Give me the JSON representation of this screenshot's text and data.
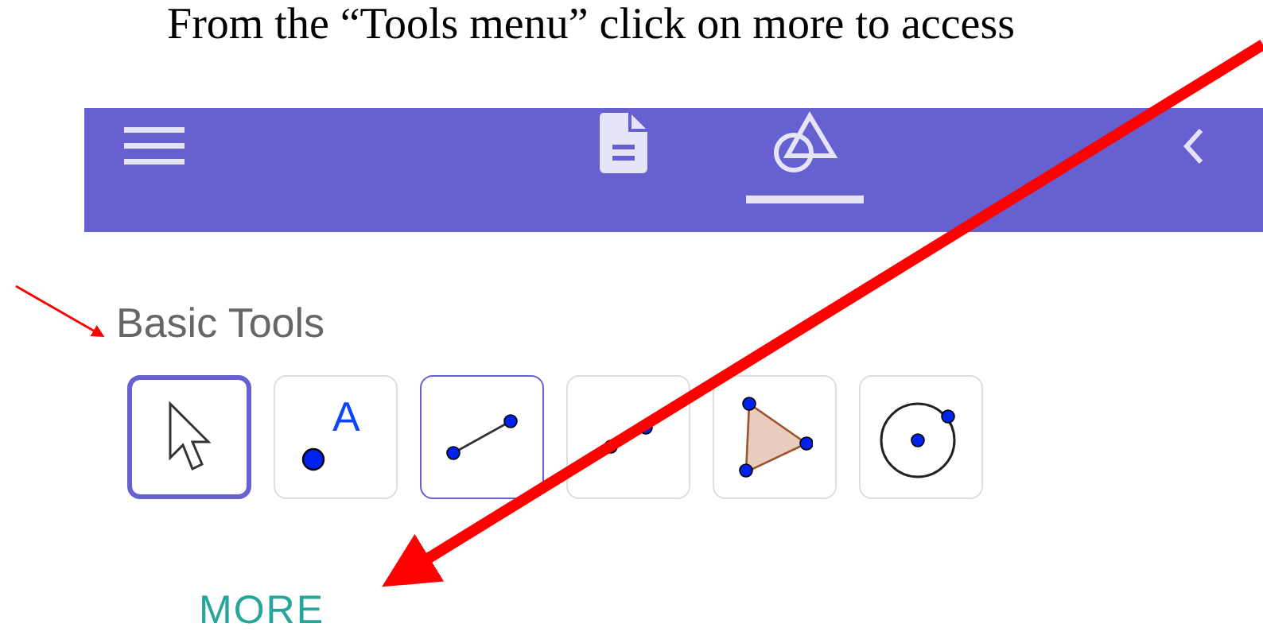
{
  "instruction": "From the “Tools menu” click on more to access",
  "toolbar": {
    "tabs": [
      {
        "kind": "document",
        "selected": false
      },
      {
        "kind": "tools",
        "selected": true
      }
    ]
  },
  "section_title": "Basic Tools",
  "tools": [
    {
      "kind": "move",
      "selected": true,
      "hovered": false
    },
    {
      "kind": "point",
      "selected": false,
      "hovered": false,
      "label": "A"
    },
    {
      "kind": "segment",
      "selected": false,
      "hovered": true
    },
    {
      "kind": "line",
      "selected": false,
      "hovered": false
    },
    {
      "kind": "polygon",
      "selected": false,
      "hovered": false
    },
    {
      "kind": "circle",
      "selected": false,
      "hovered": false
    }
  ],
  "more_link": "MORE"
}
